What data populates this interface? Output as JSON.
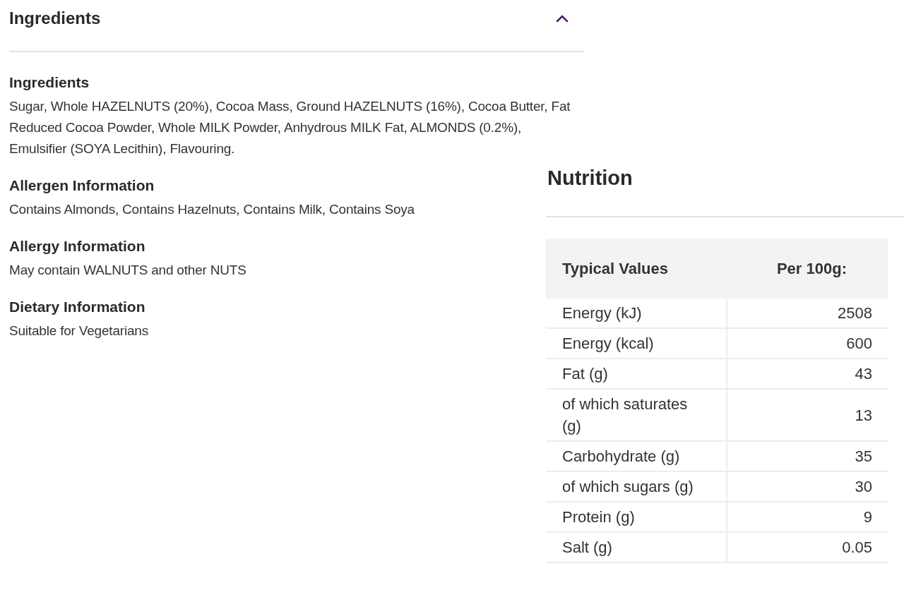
{
  "ingredients_panel": {
    "title": "Ingredients",
    "expanded": true,
    "sections": [
      {
        "heading": "Ingredients",
        "text": "Sugar, Whole HAZELNUTS (20%), Cocoa Mass, Ground HAZELNUTS (16%), Cocoa Butter, Fat Reduced Cocoa Powder, Whole MILK Powder, Anhydrous MILK Fat, ALMONDS (0.2%), Emulsifier (SOYA Lecithin), Flavouring."
      },
      {
        "heading": "Allergen Information",
        "text": "Contains Almonds, Contains Hazelnuts, Contains Milk, Contains Soya"
      },
      {
        "heading": "Allergy Information",
        "text": "May contain WALNUTS and other NUTS"
      },
      {
        "heading": "Dietary Information",
        "text": "Suitable for Vegetarians"
      }
    ]
  },
  "nutrition": {
    "title": "Nutrition",
    "columns": [
      "Typical Values",
      "Per 100g:"
    ],
    "rows": [
      [
        "Energy (kJ)",
        "2508"
      ],
      [
        "Energy (kcal)",
        "600"
      ],
      [
        "Fat (g)",
        "43"
      ],
      [
        "of which saturates (g)",
        "13"
      ],
      [
        "Carbohydrate (g)",
        "35"
      ],
      [
        "of which sugars (g)",
        "30"
      ],
      [
        "Protein (g)",
        "9"
      ],
      [
        "Salt (g)",
        "0.05"
      ]
    ]
  }
}
